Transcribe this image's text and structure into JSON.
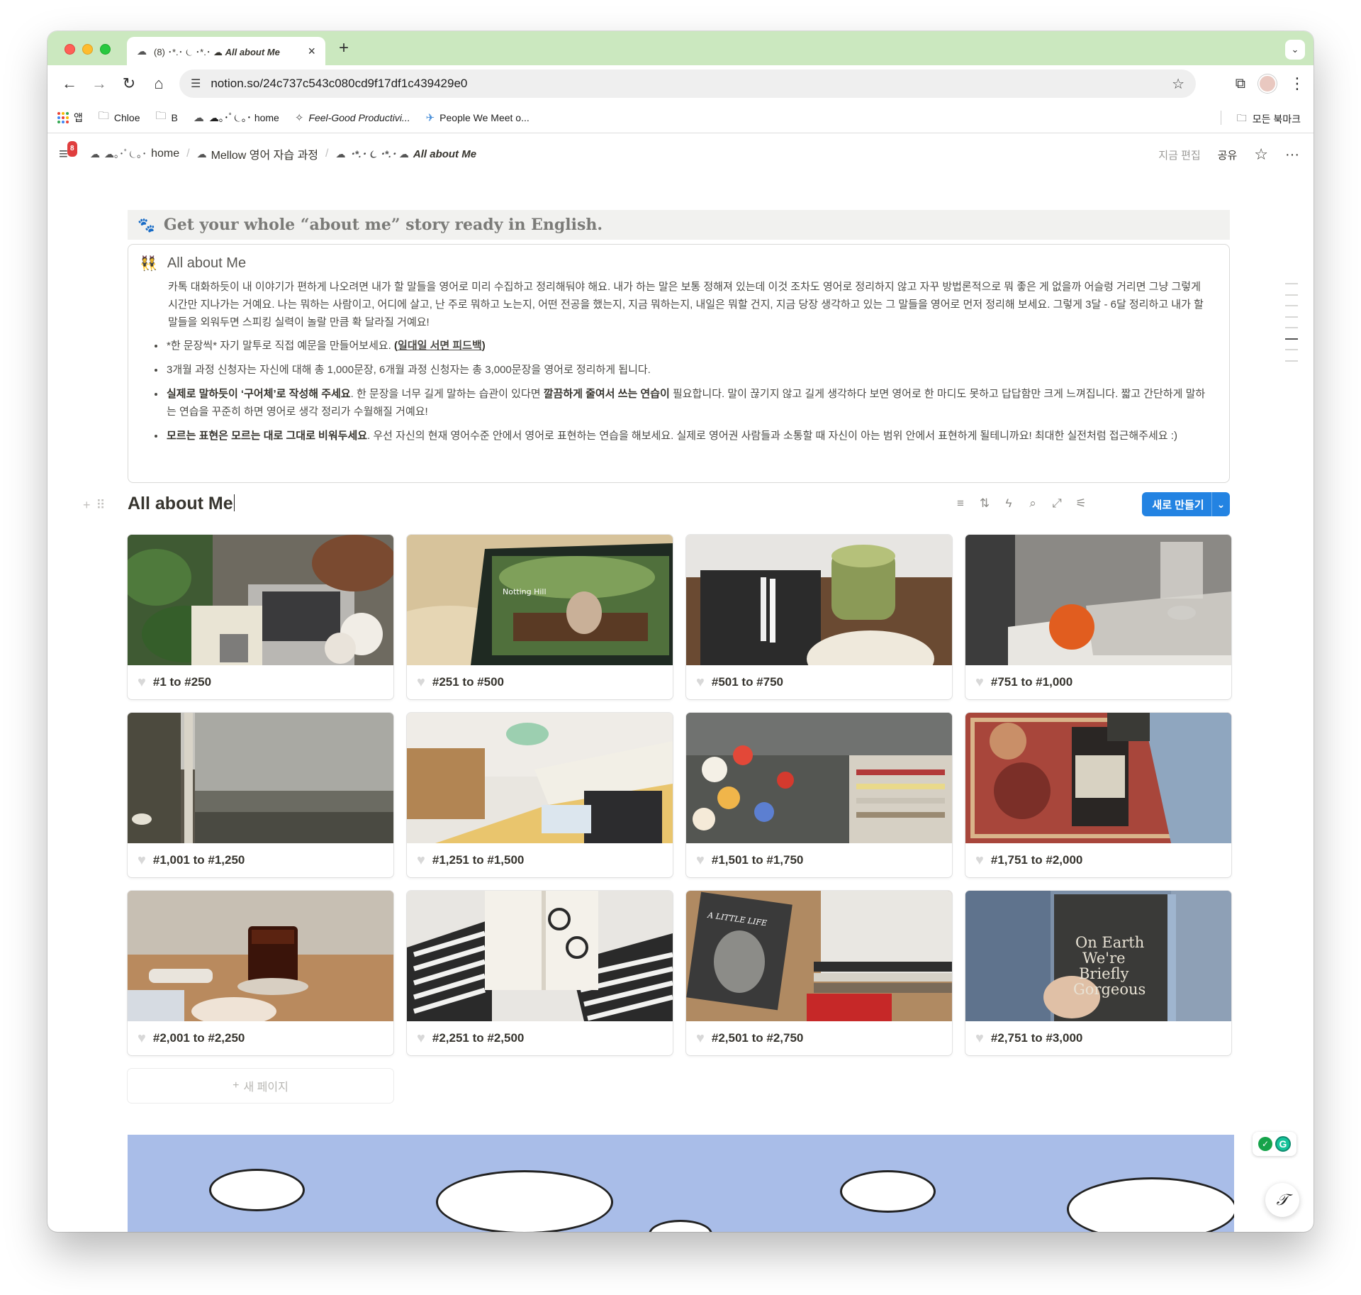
{
  "browser": {
    "tab": {
      "favicon": "notion-deco-icon",
      "title_prefix": "(8) ･*.･ ⏾ ･*.･ ☁︎",
      "title_main": "All about Me"
    },
    "address": "notion.so/24c737c543c080cd9f17df1c439429e0",
    "bookmarks": [
      {
        "label": "앱",
        "icon": "apps-icon"
      },
      {
        "label": "Chloe",
        "icon": "folder-icon"
      },
      {
        "label": "B",
        "icon": "folder-icon"
      },
      {
        "label": "☁︎｡･ﾟ⏾｡･ home",
        "icon": "notion-deco-icon"
      },
      {
        "label": "Feel-Good Productivi...",
        "icon": "sparkle-icon"
      },
      {
        "label": "People We Meet o...",
        "icon": "plane-icon"
      }
    ],
    "all_bookmarks": "모든 북마크"
  },
  "notion": {
    "badge": "8",
    "breadcrumbs": [
      {
        "deco": "☁︎｡･ﾟ⏾｡･",
        "label": "home"
      },
      {
        "deco": "",
        "label": "Mellow 영어 자습 과정"
      },
      {
        "deco": "･*.･ ⏾ ･*.･ ☁︎",
        "label": "All about Me"
      }
    ],
    "edited": "지금 편집",
    "share": "공유"
  },
  "page": {
    "callout_title": "Get your whole “about me” story ready in English.",
    "callout_heading": "All about Me",
    "callout_body": "카톡 대화하듯이 내 이야기가 편하게 나오려면 내가 할 말들을 영어로 미리 수집하고 정리해둬야 해요. 내가 하는 말은 보통 정해져 있는데 이것 조차도 영어로 정리하지 않고 자꾸 방법론적으로 뭐 좋은 게 없을까 어슬렁 거리면 그냥 그렇게 시간만 지나가는 거예요. 나는 뭐하는 사람이고, 어디에 살고, 난 주로 뭐하고 노는지, 어떤 전공을 했는지, 지금 뭐하는지, 내일은 뭐할 건지, 지금 당장 생각하고 있는 그 말들을 영어로 먼저 정리해 보세요. 그렇게 3달 - 6달 정리하고 내가 할 말들을 외워두면 스피킹 실력이 놀랄 만큼 확 달라질 거예요!",
    "bullets": [
      {
        "pre": "*한 문장씩* 자기 말투로 직접 예문을 만들어보세요. ",
        "bold": "(",
        "link": "일대일 서면 피드백",
        "post": ")"
      },
      {
        "pre": "3개월 과정 신청자는 자신에 대해 총 1,000문장, 6개월 과정 신청자는 총 3,000문장을 영어로 정리하게 됩니다.",
        "bold": "",
        "link": "",
        "post": ""
      },
      {
        "pre": "",
        "bold": "실제로 말하듯이 ‘구어체’로 작성해 주세요",
        "mid": ". 한 문장을 너무 길게 말하는 습관이 있다면 ",
        "bold2": "깔끔하게 줄여서 쓰는 연습이",
        "post": " 필요합니다. 말이 끊기지 않고 길게 생각하다 보면 영어로 한 마디도 못하고 답답함만 크게 느껴집니다. 짧고 간단하게 말하는 연습을 꾸준히 하면 영어로 생각 정리가 수월해질 거예요!"
      },
      {
        "pre": "",
        "bold": "모르는 표현은 모르는 대로 그대로 비워두세요",
        "mid": ". 우선 자신의 현재 영어수준 안에서 영어로 표현하는 연습을 해보세요. 실제로 영어권 사람들과 소통할 때 자신이 아는 범위 안에서 표현하게 될테니까요! 최대한 실전처럼 접근해주세요 :)",
        "bold2": "",
        "post": ""
      }
    ],
    "db_title": "All about Me",
    "new_button": "새로 만들기",
    "new_page": "새 페이지",
    "cards": [
      "#1 to #250",
      "#251 to #500",
      "#501 to #750",
      "#751 to #1,000",
      "#1,001 to #1,250",
      "#1,251 to #1,500",
      "#1,501 to #1,750",
      "#1,751 to #2,000",
      "#2,001 to #2,250",
      "#2,251 to #2,500",
      "#2,501 to #2,750",
      "#2,751 to #3,000"
    ],
    "cover_texts": {
      "c2": "Notting Hill",
      "c11": "A LITTLE LIFE",
      "c12a": "On Earth",
      "c12b": "We're",
      "c12c": "Briefly",
      "c12d": "Gorgeous"
    }
  }
}
